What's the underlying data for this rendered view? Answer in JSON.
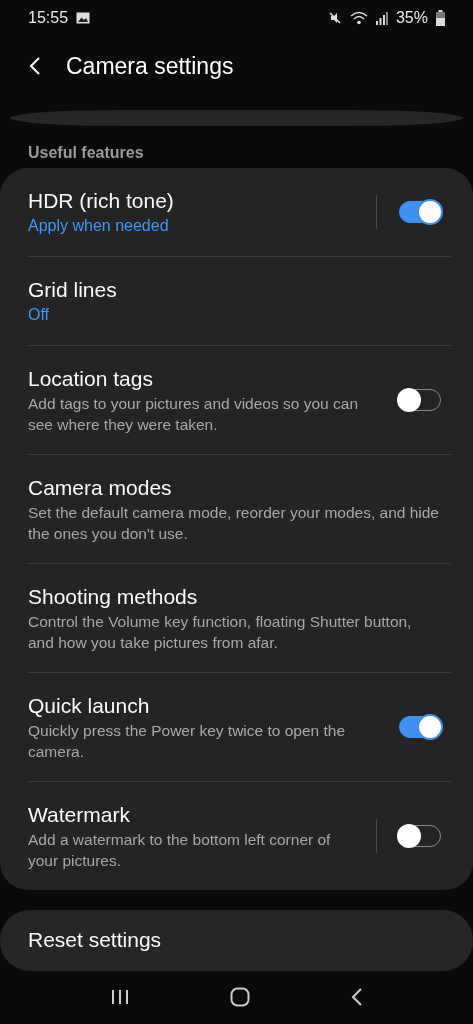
{
  "status_bar": {
    "time": "15:55",
    "battery": "35%"
  },
  "header": {
    "title": "Camera settings"
  },
  "section": {
    "label": "Useful features"
  },
  "items": [
    {
      "title": "HDR (rich tone)",
      "value": "Apply when needed",
      "toggle": {
        "on": true,
        "split": true
      }
    },
    {
      "title": "Grid lines",
      "value": "Off"
    },
    {
      "title": "Location tags",
      "description": "Add tags to your pictures and videos so you can see where they were taken.",
      "toggle": {
        "on": false,
        "split": false
      }
    },
    {
      "title": "Camera modes",
      "description": "Set the default camera mode, reorder your modes, and hide the ones you don't use."
    },
    {
      "title": "Shooting methods",
      "description": "Control the Volume key function, floating Shutter button, and how you take pictures from afar."
    },
    {
      "title": "Quick launch",
      "description": "Quickly press the Power key twice to open the camera.",
      "toggle": {
        "on": true,
        "split": false
      }
    },
    {
      "title": "Watermark",
      "description": "Add a watermark to the bottom left corner of your pictures.",
      "toggle": {
        "on": false,
        "split": true
      }
    }
  ],
  "reset": {
    "title": "Reset settings"
  }
}
